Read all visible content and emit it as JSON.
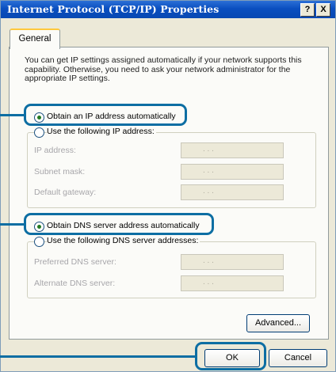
{
  "window": {
    "title": "Internet Protocol (TCP/IP) Properties",
    "help_button": "?",
    "close_button": "X"
  },
  "tabs": [
    {
      "label": "General"
    }
  ],
  "description": "You can get IP settings assigned automatically if your network supports this capability. Otherwise, you need to ask your network administrator for the appropriate IP settings.",
  "ip": {
    "auto_label": "Obtain an IP address automatically",
    "auto_selected": true,
    "manual_label": "Use the following IP address:",
    "fields": [
      {
        "label": "IP address:",
        "value": ". . ."
      },
      {
        "label": "Subnet mask:",
        "value": ". . ."
      },
      {
        "label": "Default gateway:",
        "value": ". . ."
      }
    ]
  },
  "dns": {
    "auto_label": "Obtain DNS server address automatically",
    "auto_selected": true,
    "manual_label": "Use the following DNS server addresses:",
    "fields": [
      {
        "label": "Preferred DNS server:",
        "value": ". . ."
      },
      {
        "label": "Alternate DNS server:",
        "value": ". . ."
      }
    ]
  },
  "buttons": {
    "advanced": "Advanced...",
    "ok": "OK",
    "cancel": "Cancel"
  },
  "colors": {
    "titlebar": "#0a4fc0",
    "highlight": "#0d6ea3",
    "dialog_bg": "#ece9d8"
  }
}
